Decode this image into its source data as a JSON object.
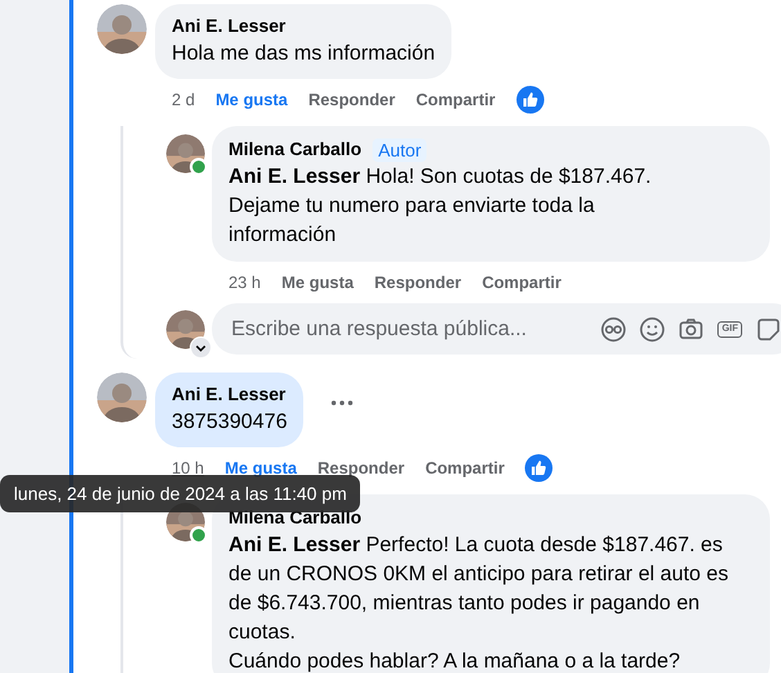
{
  "comments": [
    {
      "author": "Ani E. Lesser",
      "text": "Hola me das ms información",
      "highlighted": false,
      "has_more": false,
      "time": "2 d",
      "time_hovered": false,
      "liked": true,
      "actions": [
        "Me gusta",
        "Responder",
        "Compartir"
      ],
      "reacted": true,
      "replies": [
        {
          "author": "Milena Carballo",
          "badge": "Autor",
          "online": true,
          "text": "**Ani E. Lesser** Hola! Son cuotas de $187.467.\nDejame tu numero para enviarte toda la\ninformación",
          "time": "23 h",
          "liked": false,
          "actions": [
            "Me gusta",
            "Responder",
            "Compartir"
          ]
        }
      ],
      "reply_box": {
        "placeholder": "Escribe una respuesta pública...",
        "gif_label": "GIF"
      }
    },
    {
      "author": "Ani E. Lesser",
      "text": "3875390476",
      "highlighted": true,
      "has_more": true,
      "time": "10 h",
      "time_hovered": true,
      "time_tooltip": "lunes, 24 de junio de 2024 a las 11:40 pm",
      "liked": true,
      "actions": [
        "Me gusta",
        "Responder",
        "Compartir"
      ],
      "reacted": true,
      "replies": [
        {
          "author": "Milena Carballo",
          "online": true,
          "text": "**Ani E. Lesser** Perfecto! La cuota desde $187.467. es de un CRONOS 0KM el anticipo para retirar el auto es de $6.743.700, mientras tanto podes ir pagando en cuotas.\nCuándo podes hablar? A la mañana o a la tarde?"
        }
      ]
    }
  ]
}
